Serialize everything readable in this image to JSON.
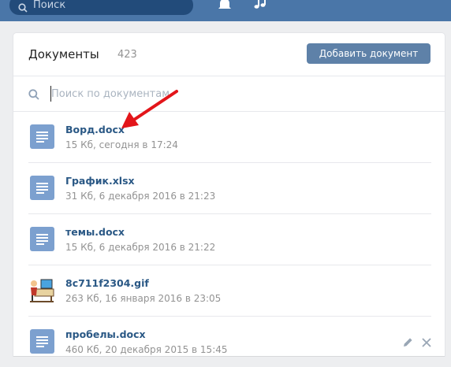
{
  "topbar": {
    "search_placeholder": "Поиск",
    "icons": [
      "search-icon",
      "bell-icon",
      "music-icon"
    ]
  },
  "docs_page": {
    "title": "Документы",
    "count": "423",
    "add_button_label": "Добавить документ",
    "search_placeholder": "Поиск по документам"
  },
  "documents": [
    {
      "name": "Ворд.docx",
      "meta": "15 Кб, сегодня в 17:24",
      "icon": "document-icon"
    },
    {
      "name": "График.xlsx",
      "meta": "31 Кб, 6 декабря 2016 в 21:23",
      "icon": "document-icon"
    },
    {
      "name": "темы.docx",
      "meta": "15 Кб, 6 декабря 2016 в 21:22",
      "icon": "document-icon"
    },
    {
      "name": "8c711f2304.gif",
      "meta": "263 Кб, 16 января 2016 в 23:05",
      "icon": "gif-thumbnail"
    },
    {
      "name": "пробелы.docx",
      "meta": "460 Кб, 20 декабря 2015 в 15:45",
      "icon": "document-icon"
    }
  ],
  "colors": {
    "header": "#4a76a8",
    "background": "#edeef0",
    "link": "#2a5885",
    "button": "#5e81a8",
    "doc_icon": "#7ca0cf",
    "annotation_arrow": "#e3151a"
  }
}
